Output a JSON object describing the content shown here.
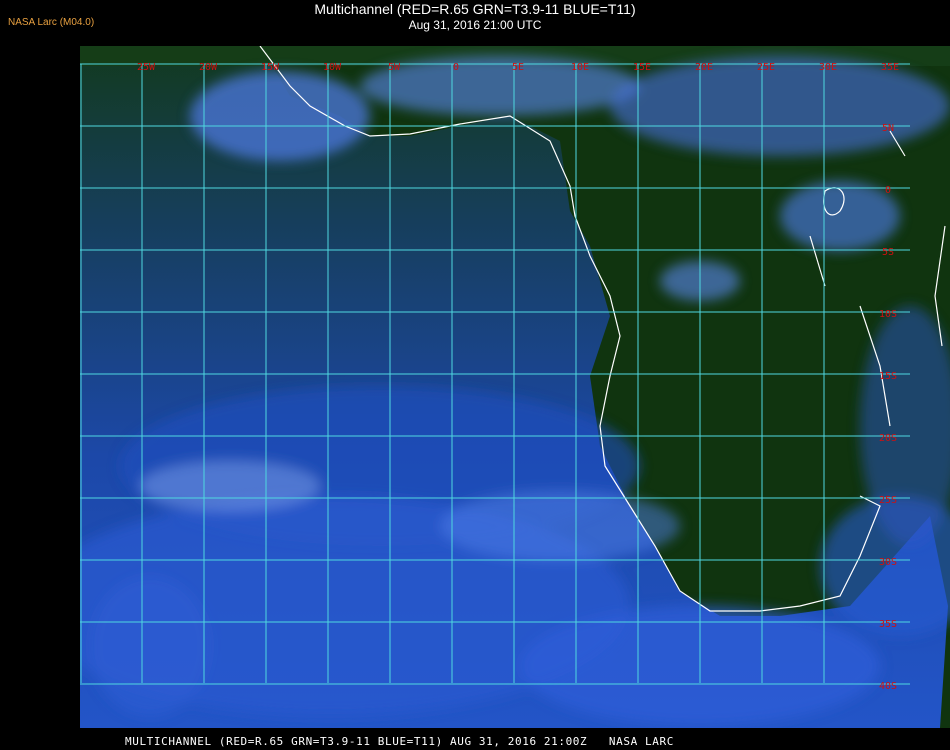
{
  "header": {
    "version_label": "NASA Larc (M04.0)",
    "title": "Multichannel (RED=R.65 GRN=T3.9-11 BLUE=T11)",
    "subtitle": "Aug 31, 2016 21:00 UTC"
  },
  "map": {
    "longitude_labels": [
      "25W",
      "20W",
      "15W",
      "10W",
      "5W",
      "0",
      "5E",
      "10E",
      "15E",
      "20E",
      "25E",
      "30E",
      "35E"
    ],
    "latitude_labels": [
      "5N",
      "0",
      "5S",
      "10S",
      "15S",
      "20S",
      "25S",
      "30S",
      "35S",
      "40S"
    ],
    "grid_color": "#4fd8e0",
    "label_color": "#d01010",
    "coastline_color": "#ffffff",
    "ocean_color": "#1a4ab0",
    "land_color": "#10340f",
    "cloud_color": "#5a8cff"
  },
  "footer": {
    "text": "MULTICHANNEL (RED=R.65 GRN=T3.9-11 BLUE=T11) AUG 31, 2016 21:00Z   NASA LARC"
  }
}
